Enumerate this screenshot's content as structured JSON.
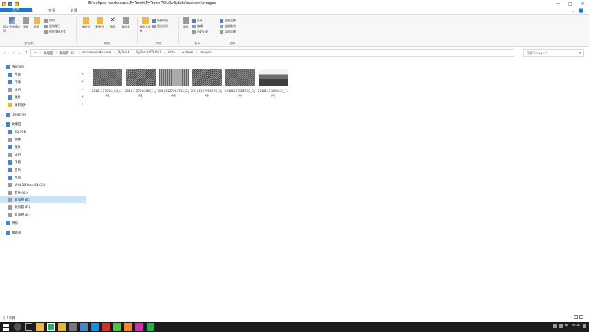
{
  "window": {
    "title": "E:\\eclipse-workspace\\PyTorch\\PyTorch-YOLOv3\\data\\custom\\images",
    "controls": [
      "—",
      "□",
      "✕"
    ]
  },
  "ribbon_tabs": {
    "file": "文件",
    "home": "主页",
    "share": "共享",
    "view": "查看",
    "manage": "管理",
    "help": "?"
  },
  "ribbon": {
    "clipboard": {
      "label": "剪贴板",
      "pin": "固定到快速访问",
      "copy": "复制",
      "paste": "粘贴",
      "cut": "剪切",
      "copy_path": "复制路径",
      "paste_shortcut": "粘贴快捷方式"
    },
    "organize": {
      "label": "组织",
      "move_to": "移动到",
      "copy_to": "复制到",
      "delete": "删除",
      "rename": "重命名"
    },
    "new": {
      "label": "新建",
      "new_folder": "新建文件夹",
      "new_item": "新建项目",
      "easy_access": "轻松访问"
    },
    "open": {
      "label": "打开",
      "properties": "属性",
      "open": "打开",
      "edit": "编辑",
      "history": "历史记录"
    },
    "select": {
      "label": "选择",
      "select_all": "全部选择",
      "select_none": "全部取消",
      "invert": "反向选择"
    }
  },
  "address": {
    "crumbs": [
      "此电脑",
      "新加卷 (E:)",
      "eclipse-workspace",
      "PyTorch",
      "PyTorch-YOLOv3",
      "data",
      "custom",
      "images"
    ],
    "search_placeholder": "搜索\"images\""
  },
  "nav": {
    "quick_access": "快速访问",
    "desktop": "桌面",
    "downloads": "下载",
    "documents": "文档",
    "pictures": "图片",
    "recordings": "录制图片",
    "onedrive": "OneDrive",
    "this_pc": "此电脑",
    "objects3d": "3D 对象",
    "videos": "视频",
    "pictures2": "图片",
    "documents2": "文档",
    "downloads2": "下载",
    "music": "音乐",
    "desktop2": "桌面",
    "drive_c": "WIN 10 Pro x64 (C:)",
    "drive_d": "软件 (D:)",
    "drive_e": "新加卷 (E:)",
    "drive_f": "新加卷 (F:)",
    "drive_g": "新加卷 (G:)",
    "network": "网络",
    "homegroup": "家庭组"
  },
  "files": [
    {
      "name": "20181127085424_6.jpg"
    },
    {
      "name": "20181127085109_1.jpg"
    },
    {
      "name": "20181127084715_2.jpg"
    },
    {
      "name": "20181127085579_3.jpg"
    },
    {
      "name": "20181127085758_2.jpg"
    },
    {
      "name": "20181127090214_7.jpg"
    }
  ],
  "status": {
    "count": "6 个项目"
  },
  "taskbar": {
    "time": "20:46",
    "input": "中"
  },
  "colors": {
    "accent": "#1979ca",
    "selected": "#cce4f7",
    "taskbar": "#1c1c1c"
  }
}
